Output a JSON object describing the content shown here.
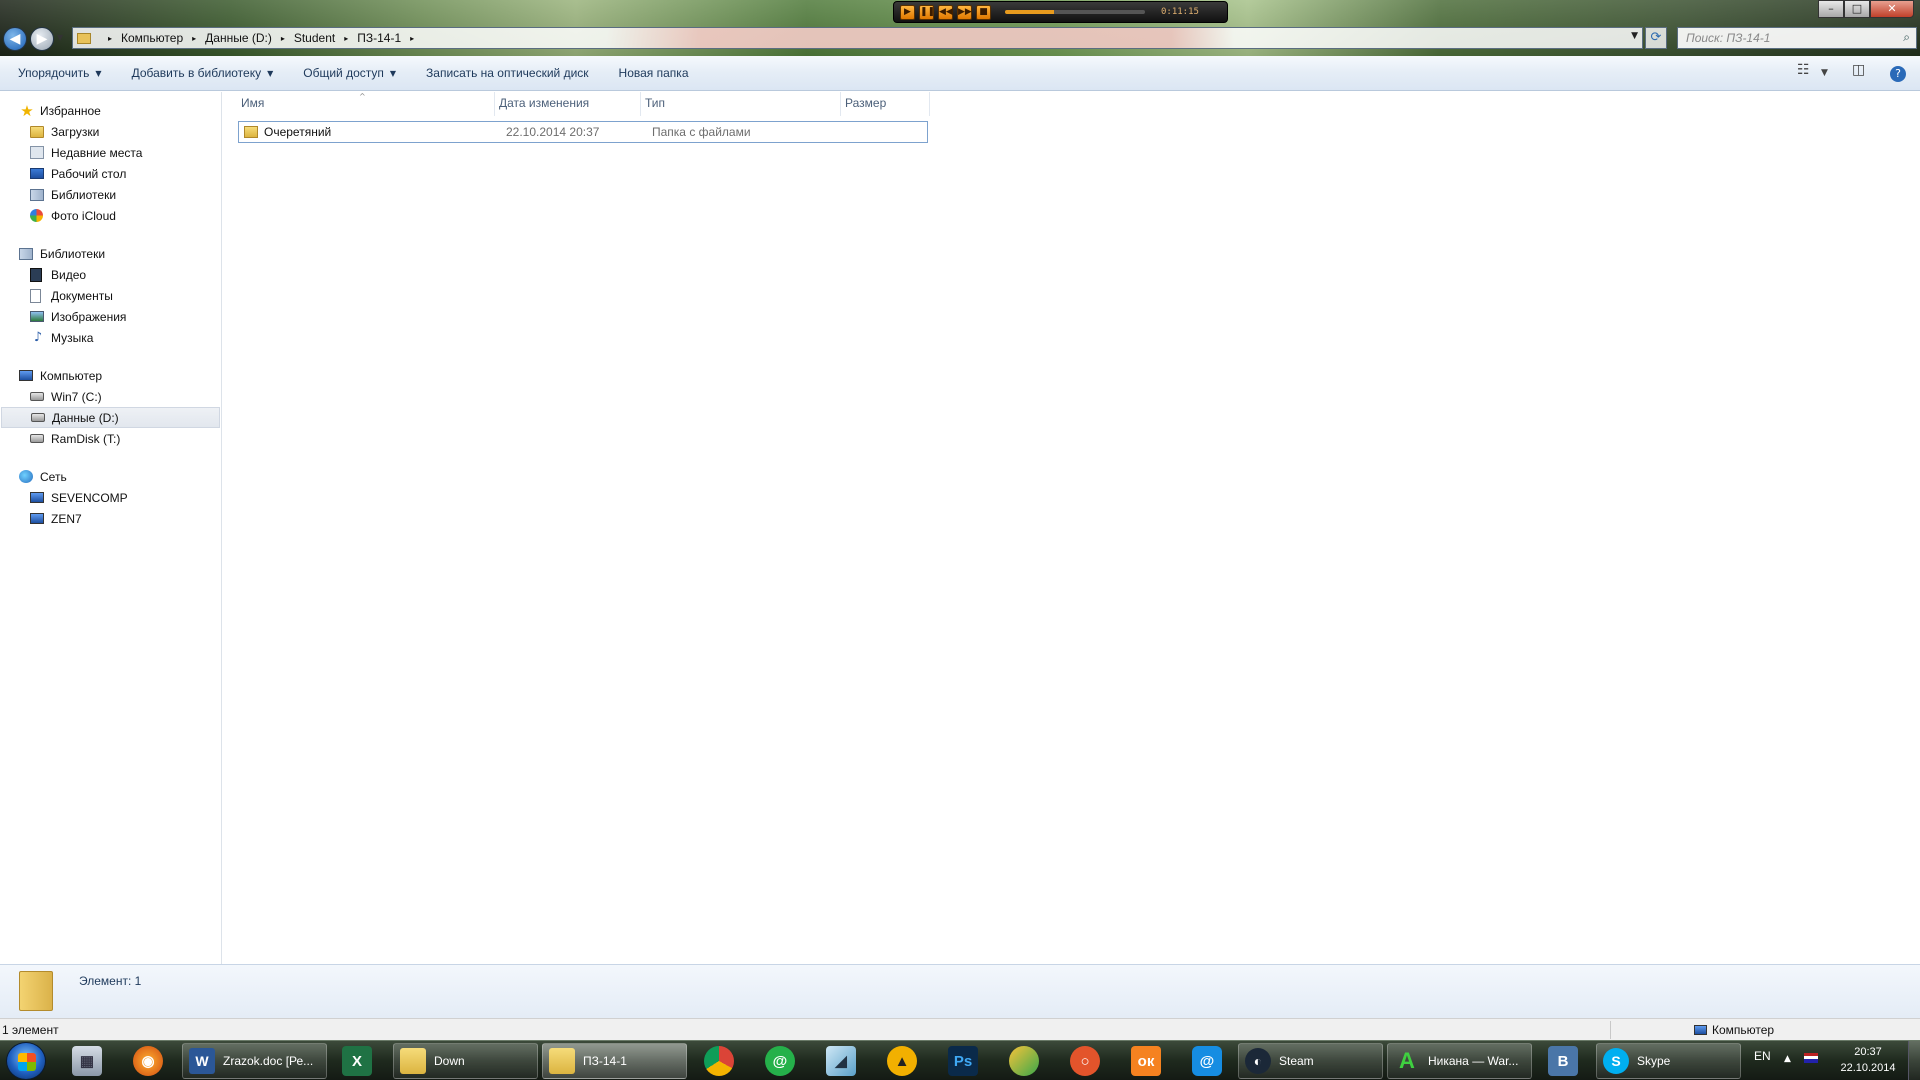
{
  "player": {
    "buttons": [
      "▶",
      "❚❚",
      "◀◀",
      "▶▶",
      "■"
    ],
    "time": "0:11:15",
    "progress": 0.35
  },
  "window_controls": {
    "minimize": "–",
    "maximize": "□",
    "close": "✕"
  },
  "address": {
    "crumbs": [
      "Компьютер",
      "Данные (D:)",
      "Student",
      "ПЗ-14-1"
    ],
    "separator": "▸"
  },
  "search": {
    "placeholder": "Поиск: ПЗ-14-1"
  },
  "toolbar": {
    "organize": "Упорядочить",
    "add_to_library": "Добавить в библиотеку",
    "share": "Общий доступ",
    "burn": "Записать на оптический диск",
    "new_folder": "Новая папка"
  },
  "sidebar": {
    "favorites": {
      "label": "Избранное",
      "items": [
        "Загрузки",
        "Недавние места",
        "Рабочий стол",
        "Библиотеки",
        "Фото iCloud"
      ]
    },
    "libraries": {
      "label": "Библиотеки",
      "items": [
        "Видео",
        "Документы",
        "Изображения",
        "Музыка"
      ]
    },
    "computer": {
      "label": "Компьютер",
      "items": [
        "Win7 (C:)",
        "Данные (D:)",
        "RamDisk (T:)"
      ],
      "selected": "Данные (D:)"
    },
    "network": {
      "label": "Сеть",
      "items": [
        "SEVENCOMP",
        "ZEN7"
      ]
    }
  },
  "columns": {
    "name": "Имя",
    "date": "Дата изменения",
    "type": "Тип",
    "size": "Размер"
  },
  "files": [
    {
      "name": "Очеретяний",
      "date": "22.10.2014 20:37",
      "type": "Папка с файлами",
      "size": ""
    }
  ],
  "details": {
    "count_text": "Элемент: 1"
  },
  "status": {
    "left": "1 элемент",
    "right": "Компьютер"
  },
  "taskbar": {
    "windows": [
      "Zrazok.doc [Ре...",
      "Down",
      "ПЗ-14-1",
      "Steam",
      "Никана — War...",
      "Skype"
    ],
    "language": "EN",
    "time": "20:37",
    "date": "22.10.2014"
  },
  "colors": {
    "accent": "#1e395b",
    "selection_border": "#7da2ce"
  }
}
